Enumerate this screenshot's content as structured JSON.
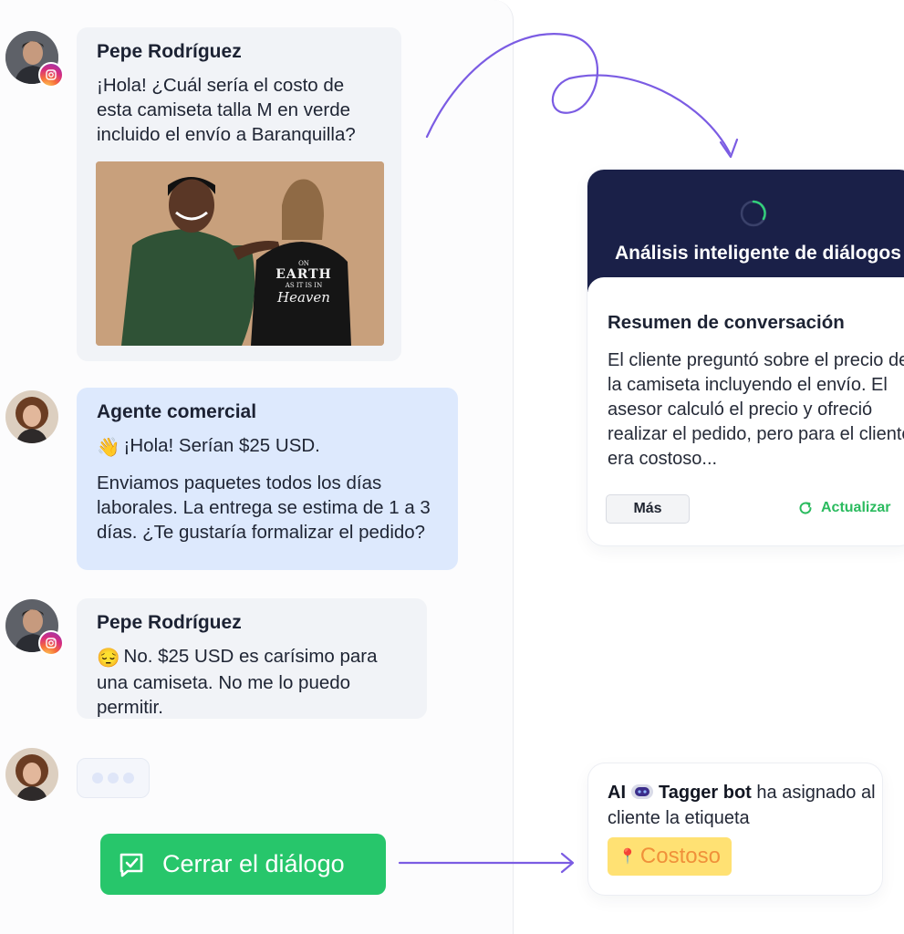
{
  "chat": {
    "messages": [
      {
        "sender": "Pepe Rodríguez",
        "role": "client",
        "channel": "instagram",
        "text": "¡Hola! ¿Cuál sería el costo de esta camiseta talla M en verde incluido el envío a Baranquilla?",
        "attachment": "product-photo",
        "photo_text": {
          "line1": "ON",
          "line2": "EARTH",
          "line3": "AS IT IS IN",
          "line4": "Heaven"
        }
      },
      {
        "sender": "Agente comercial",
        "role": "agent",
        "emoji": "👋",
        "text": "¡Hola! Serían $25 USD.",
        "text2": "Enviamos paquetes todos los días laborales. La entrega se estima de 1 a 3 días. ¿Te gustaría formalizar el pedido?"
      },
      {
        "sender": "Pepe Rodríguez",
        "role": "client",
        "channel": "instagram",
        "emoji": "😔",
        "text": "No. $25 USD es carísimo para una camiseta. No me lo puedo permitir."
      }
    ],
    "typing_indicator": true,
    "close_button": {
      "label": "Cerrar el diálogo",
      "icon": "chat-check-icon"
    }
  },
  "analysis_card": {
    "title": "Análisis inteligente de diálogos",
    "summary_title": "Resumen de conversación",
    "summary_text": "El cliente preguntó sobre el precio de la camiseta incluyendo el envío. El asesor calculó el precio y ofreció realizar el pedido, pero para el cliente era costoso...",
    "more_label": "Más",
    "refresh_label": "Actualizar"
  },
  "tag_card": {
    "prefix": "AI",
    "bot_name": "Tagger bot",
    "text_after": " ha asignado al cliente la etiqueta",
    "tag_icon": "📍",
    "tag_label": "Costoso"
  },
  "colors": {
    "green": "#27c66b",
    "navy": "#1a2048",
    "agent_bubble": "#dde9fd",
    "client_bubble": "#f1f3f7",
    "arrow": "#7b5ce3",
    "tag_yellow": "#ffe173",
    "tag_text": "#f0913a"
  }
}
